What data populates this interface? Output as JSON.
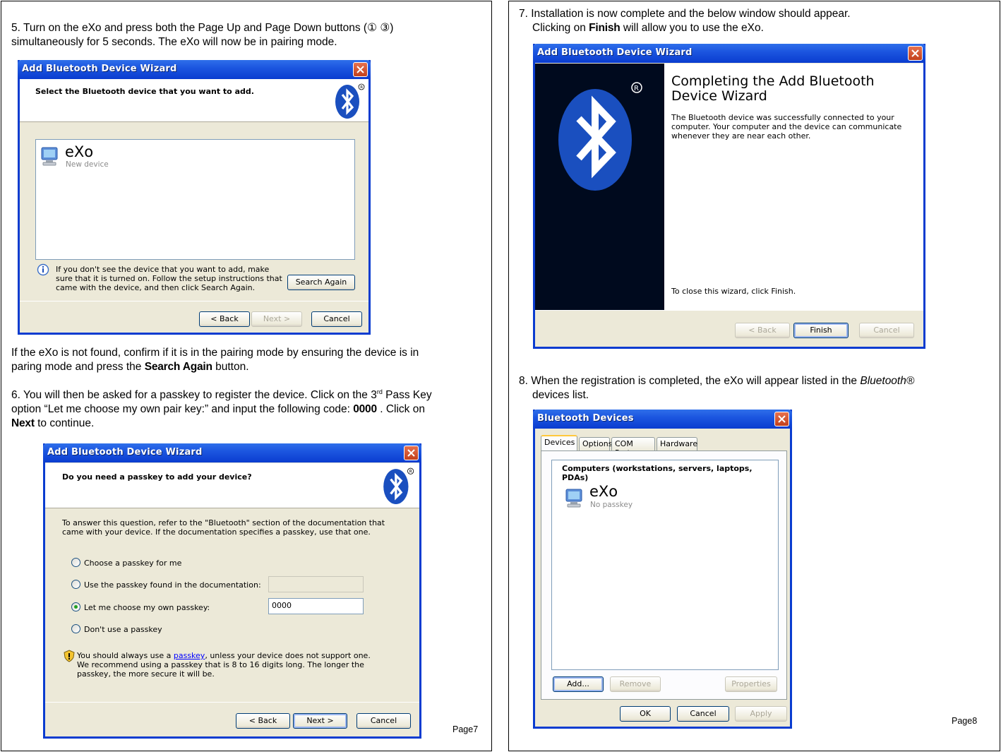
{
  "page7": {
    "step5": {
      "before": "5. Turn on the eXo and press both the Page Up and Page Down buttons (",
      "sym1": "①",
      "sym2": "③",
      "after": ")",
      "line2": "simultaneously for 5 seconds. The eXo will now be in pairing mode."
    },
    "notfound": {
      "line1": "If the eXo is not found, confirm if it is in the pairing mode  by ensuring the device is in",
      "line2_before": "paring mode and press the ",
      "line2_bold": "Search Again",
      "line2_after": " button."
    },
    "step6": {
      "line1_before": "6. You will then be asked for a passkey to register the device. Click on the 3",
      "line1_sup": "rd",
      "line1_after": " Pass Key",
      "line2_before": "option “Let me choose my own pair key:” and input the following code: ",
      "line2_bold": "0000",
      "line2_after": " .  Click on",
      "line3_bold": "Next",
      "line3_after": " to continue."
    },
    "page_number": "Page7"
  },
  "dialog_select": {
    "title": "Add Bluetooth Device Wizard",
    "header": "Select the Bluetooth device that you want to add.",
    "device_name": "eXo",
    "device_status": "New device",
    "info_text": "If you don't see the device that you want to add, make sure that it is turned on. Follow the setup instructions that came with the device, and then click Search Again.",
    "search_again": "Search Again",
    "back": "< Back",
    "next": "Next >",
    "cancel": "Cancel"
  },
  "dialog_passkey": {
    "title": "Add Bluetooth Device Wizard",
    "header": "Do you need a passkey to add your device?",
    "intro": "To answer this question, refer to the \"Bluetooth\" section of the documentation that came with your device. If the documentation specifies a passkey, use that one.",
    "options": [
      "Choose a passkey for me",
      "Use the passkey found in the documentation:",
      "Let me choose my own passkey:",
      "Don't use a passkey"
    ],
    "passkey_value": "0000",
    "warn_before": "You should always use a ",
    "warn_link": "passkey",
    "warn_after": ", unless your device does not support one. We recommend using a passkey that is 8 to 16 digits long. The longer the passkey, the more secure it will be.",
    "back": "< Back",
    "next": "Next >",
    "cancel": "Cancel"
  },
  "page8": {
    "step7": {
      "line1": "7. Installation is now complete and the below window should appear.",
      "line2_before": "Clicking on ",
      "line2_bold": "Finish",
      "line2_after": " will allow you to use the eXo."
    },
    "step8": {
      "line1_before": "8. When the registration is completed, the eXo will appear listed in the ",
      "line1_italic": "Bluetooth®",
      "line2": "devices list."
    },
    "page_number": "Page8"
  },
  "dialog_complete": {
    "title": "Add Bluetooth Device Wizard",
    "heading": "Completing the Add Bluetooth Device Wizard",
    "body": "The Bluetooth device was successfully connected to your computer. Your computer and the device can communicate whenever they are near each other.",
    "close_hint": "To close this wizard, click Finish.",
    "back": "< Back",
    "finish": "Finish",
    "cancel": "Cancel"
  },
  "dialog_devices": {
    "title": "Bluetooth Devices",
    "tabs": [
      "Devices",
      "Options",
      "COM Ports",
      "Hardware"
    ],
    "group_header": "Computers (workstations, servers, laptops, PDAs)",
    "device_name": "eXo",
    "device_status": "No passkey",
    "add": "Add...",
    "remove": "Remove",
    "properties": "Properties",
    "ok": "OK",
    "cancel": "Cancel",
    "apply": "Apply"
  },
  "colors": {
    "xp_title_blue": "#0a3cd0",
    "xp_face": "#ece9d8",
    "bluetooth_blue": "#1a4fbf"
  }
}
